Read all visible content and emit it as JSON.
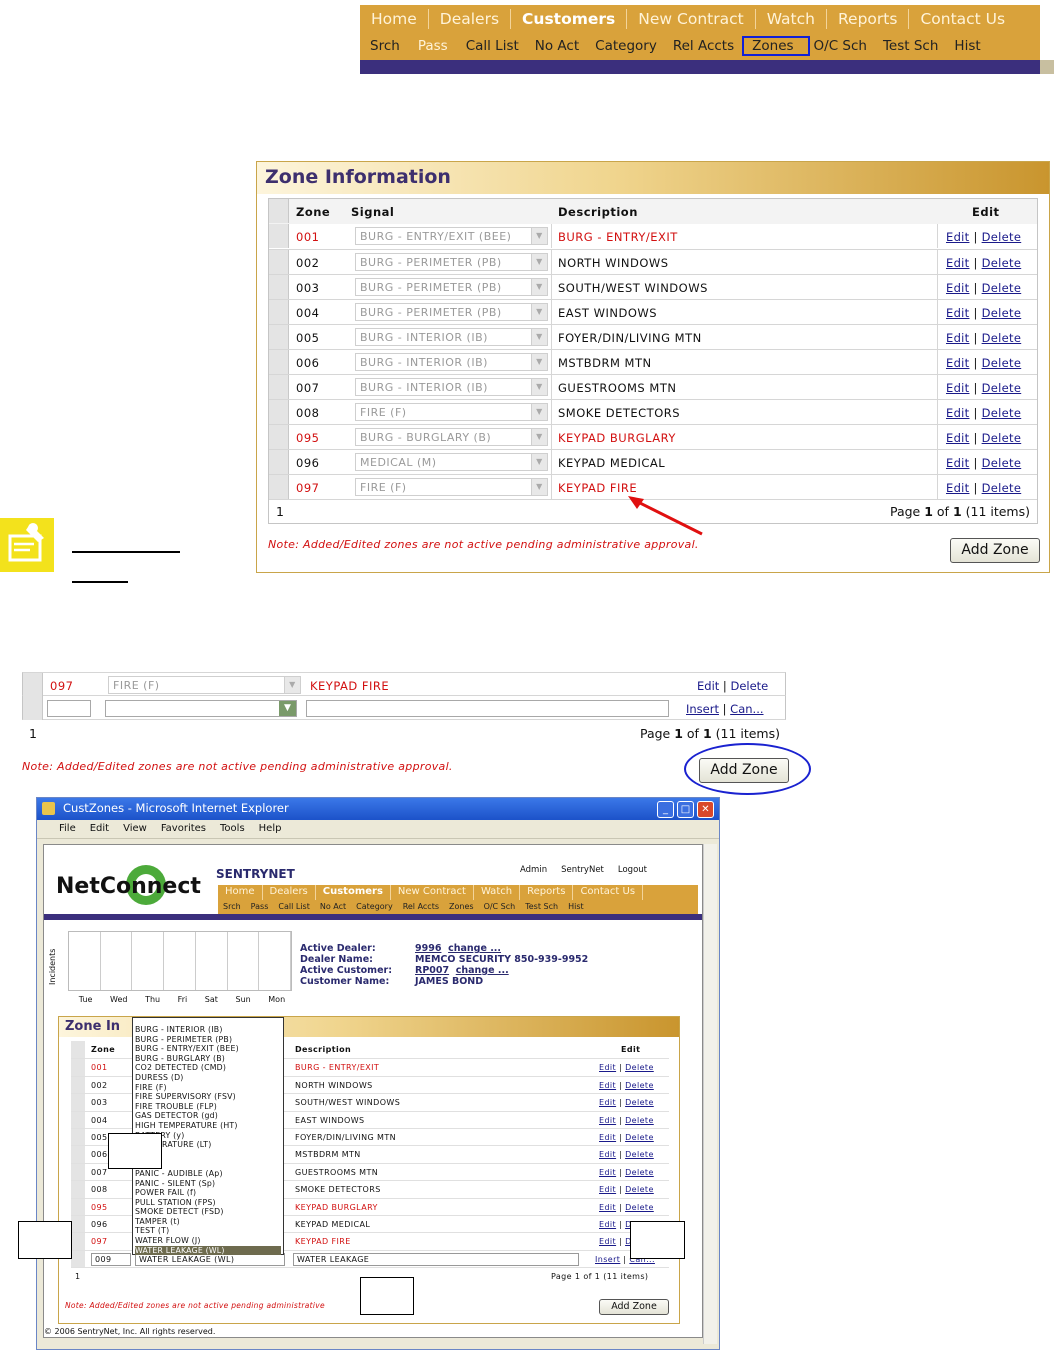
{
  "top_nav": {
    "primary": [
      "Home",
      "Dealers",
      "Customers",
      "New Contract",
      "Watch",
      "Reports",
      "Contact Us"
    ],
    "active_primary": "Customers",
    "secondary": [
      "Srch",
      "Pass",
      "Call List",
      "No Act",
      "Category",
      "Rel Accts",
      "Zones",
      "O/C Sch",
      "Test Sch",
      "Hist"
    ],
    "highlighted_secondary": "Zones",
    "colors": {
      "nav_bg": "#d9a23b",
      "bar": "#3b2f7d",
      "highlight_box": "#1020d8"
    }
  },
  "zone_panel": {
    "title": "Zone Information",
    "headers": {
      "zone": "Zone",
      "signal": "Signal",
      "description": "Description",
      "edit": "Edit"
    },
    "rows": [
      {
        "zone": "001",
        "signal": "BURG - ENTRY/EXIT (BEE)",
        "description": "BURG - ENTRY/EXIT",
        "red": true
      },
      {
        "zone": "002",
        "signal": "BURG - PERIMETER (PB)",
        "description": "NORTH WINDOWS",
        "red": false
      },
      {
        "zone": "003",
        "signal": "BURG - PERIMETER (PB)",
        "description": "SOUTH/WEST WINDOWS",
        "red": false
      },
      {
        "zone": "004",
        "signal": "BURG - PERIMETER (PB)",
        "description": "EAST WINDOWS",
        "red": false
      },
      {
        "zone": "005",
        "signal": "BURG - INTERIOR (IB)",
        "description": "FOYER/DIN/LIVING MTN",
        "red": false
      },
      {
        "zone": "006",
        "signal": "BURG - INTERIOR (IB)",
        "description": "MSTBDRM MTN",
        "red": false
      },
      {
        "zone": "007",
        "signal": "BURG - INTERIOR (IB)",
        "description": "GUESTROOMS MTN",
        "red": false
      },
      {
        "zone": "008",
        "signal": "FIRE (F)",
        "description": "SMOKE DETECTORS",
        "red": false
      },
      {
        "zone": "095",
        "signal": "BURG - BURGLARY (B)",
        "description": "KEYPAD BURGLARY",
        "red": true
      },
      {
        "zone": "096",
        "signal": "MEDICAL (M)",
        "description": "KEYPAD MEDICAL",
        "red": false
      },
      {
        "zone": "097",
        "signal": "FIRE (F)",
        "description": "KEYPAD FIRE",
        "red": true
      }
    ],
    "edit_label": "Edit",
    "delete_label": "Delete",
    "separator": "|",
    "pager_left": "1",
    "pager_right": "Page 1 of 1 (11 items)",
    "note": "Note: Added/Edited zones are not active pending administrative approval.",
    "add_zone_button": "Add Zone",
    "colors": {
      "red": "#d21010",
      "link": "#1a1a8a",
      "title": "#3d2f6e"
    }
  },
  "zoom_strip": {
    "row_zone": "097",
    "row_signal": "FIRE (F)",
    "row_description": "KEYPAD FIRE",
    "edit_label": "Edit",
    "delete_label": "Delete",
    "insert_label": "Insert",
    "cancel_label": "Can...",
    "pager_left": "1",
    "pager_right": "Page 1 of 1 (11 items)",
    "note": "Note: Added/Edited zones are not active pending administrative approval.",
    "add_zone_button": "Add Zone"
  },
  "ie_window": {
    "title": "CustZones - Microsoft Internet Explorer",
    "menu": [
      "File",
      "Edit",
      "View",
      "Favorites",
      "Tools",
      "Help"
    ],
    "logo_text": "NetConnect",
    "brand": "SENTRYNET",
    "top_links": [
      "Admin",
      "SentryNet",
      "Logout"
    ],
    "nav_primary": [
      "Home",
      "Dealers",
      "Customers",
      "New Contract",
      "Watch",
      "Reports",
      "Contact Us"
    ],
    "nav_secondary": [
      "Srch",
      "Pass",
      "Call List",
      "No Act",
      "Category",
      "Rel Accts",
      "Zones",
      "O/C Sch",
      "Test Sch",
      "Hist"
    ],
    "chart_axis_label": "Incidents",
    "chart_days": [
      "Tue",
      "Wed",
      "Thu",
      "Fri",
      "Sat",
      "Sun",
      "Mon"
    ],
    "info": {
      "active_dealer_label": "Active Dealer:",
      "active_dealer": "9996",
      "change_label": "change ...",
      "dealer_name_label": "Dealer Name:",
      "dealer_name": "MEMCO SECURITY 850-939-9952",
      "active_customer_label": "Active Customer:",
      "active_customer": "RP007",
      "customer_name_label": "Customer Name:",
      "customer_name": "JAMES BOND"
    },
    "panel_title": "Zone In",
    "headers": {
      "zone": "Zone",
      "description": "Description",
      "edit": "Edit"
    },
    "rows": [
      {
        "zone": "001",
        "description": "BURG - ENTRY/EXIT",
        "red": true
      },
      {
        "zone": "002",
        "description": "NORTH WINDOWS",
        "red": false
      },
      {
        "zone": "003",
        "description": "SOUTH/WEST WINDOWS",
        "red": false
      },
      {
        "zone": "004",
        "description": "EAST WINDOWS",
        "red": false
      },
      {
        "zone": "005",
        "description": "FOYER/DIN/LIVING MTN",
        "red": false
      },
      {
        "zone": "006",
        "description": "MSTBDRM MTN",
        "red": false
      },
      {
        "zone": "007",
        "description": "GUESTROOMS MTN",
        "red": false
      },
      {
        "zone": "008",
        "description": "SMOKE DETECTORS",
        "red": false
      },
      {
        "zone": "095",
        "description": "KEYPAD BURGLARY",
        "red": true
      },
      {
        "zone": "096",
        "description": "KEYPAD MEDICAL",
        "red": false
      },
      {
        "zone": "097",
        "description": "KEYPAD FIRE",
        "red": true
      }
    ],
    "dropdown_options": [
      "BURG - INTERIOR (IB)",
      "BURG - PERIMETER (PB)",
      "BURG - ENTRY/EXIT (BEE)",
      "BURG - BURGLARY (B)",
      "CO2 DETECTED (CMD)",
      "DURESS (D)",
      "FIRE (F)",
      "FIRE SUPERVISORY (FSV)",
      "FIRE TROUBLE (FLP)",
      "GAS DETECTOR (gd)",
      "HIGH TEMPERATURE (HT)",
      "BATTERY (y)",
      "TEMPERATURE (LT)",
      "AL (M)",
      "(p)",
      "PANIC - AUDIBLE (Ap)",
      "PANIC - SILENT (Sp)",
      "POWER FAIL (f)",
      "PULL STATION (FPS)",
      "SMOKE DETECT (FSD)",
      "TAMPER (t)",
      "TEST (T)",
      "WATER FLOW (J)",
      "WATER LEAKAGE (WL)"
    ],
    "selected_option": "WATER LEAKAGE (WL)",
    "new_zone": "009",
    "new_signal": "WATER LEAKAGE (WL)",
    "new_description": "WATER LEAKAGE",
    "insert_label": "Insert",
    "cancel_label": "Can...",
    "edit_label": "Edit",
    "delete_label": "Delete",
    "pager_left": "1",
    "pager_right": "Page 1 of 1 (11 items)",
    "note": "Note: Added/Edited zones are not active pending administrative",
    "add_zone_button": "Add Zone",
    "footer": "© 2006 SentryNet, Inc. All rights reserved."
  }
}
